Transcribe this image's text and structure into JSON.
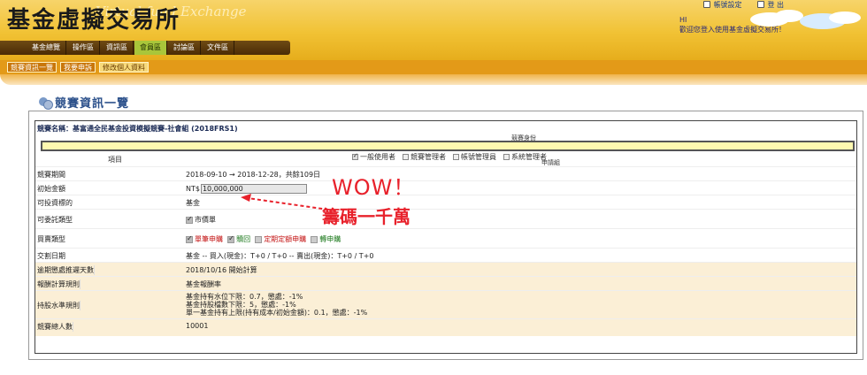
{
  "header": {
    "logo_cn": "基金虛擬交易所",
    "logo_en": "Virtual fund Exchange",
    "top_links": [
      "帳號設定",
      "登 出"
    ],
    "greeting": "HI",
    "welcome": "歡迎您登入使用基金虛擬交易所！"
  },
  "nav": {
    "tabs": [
      "基金總覽",
      "操作區",
      "資訊區",
      "會員區",
      "討論區",
      "文件區"
    ],
    "active": 3
  },
  "subnav": {
    "tabs": [
      "競賽資訊一覽",
      "我要申訴",
      "修改個人資料"
    ],
    "active": 2
  },
  "page": {
    "title": "競賽資訊一覽",
    "competition_name": "競賽名稱：基富通全民基金投資模擬競賽-社會組 (2018FRS1)"
  },
  "roles": {
    "header": "競賽身份",
    "item_label": "項目",
    "options": [
      {
        "label": "一般使用者",
        "checked": true
      },
      {
        "label": "競賽管理者",
        "checked": false
      },
      {
        "label": "帳號管理員",
        "checked": false
      },
      {
        "label": "系統管理者",
        "checked": false
      }
    ],
    "flag_label": "申請組"
  },
  "rows": [
    {
      "label": "競賽期間",
      "value": "2018-09-10 → 2018-12-28，共餘109日"
    },
    {
      "label": "初始金額",
      "prefix": "NT$",
      "input_value": "10,000,000"
    },
    {
      "label": "可投資標的",
      "value": "基金"
    },
    {
      "label": "可委託類型",
      "check_label": "市價單"
    },
    {
      "label": "買賣類型",
      "types": [
        {
          "label": "單筆申購",
          "checked": true,
          "color": "#c41616"
        },
        {
          "label": "贖回",
          "checked": true,
          "color": "#1e7a1e"
        },
        {
          "label": "定期定額申購",
          "checked": false,
          "color": "#c41616"
        },
        {
          "label": "轉申購",
          "checked": false,
          "color": "#1e7a1e"
        }
      ]
    },
    {
      "label": "交割日期",
      "value": "基金 -- 買入(現金)：T+0 / T+0 -- 賣出(現金)：T+0 / T+0"
    },
    {
      "label": "逾期懲處推遲天數",
      "value": "2018/10/16 開始計算"
    },
    {
      "label": "報酬計算規則",
      "value": "基金報酬率"
    },
    {
      "label": "持股水準規則",
      "lines": [
        "基金持有水位下限：0.7，懲處：-1%",
        "基金持股檔數下限：5，懲處：-1%",
        "單一基金持有上限(持有成本/初始金額)：0.1，懲處：-1%"
      ]
    },
    {
      "label": "競賽總人數",
      "value": "10001"
    }
  ],
  "annotation": {
    "wow": "WOW！",
    "note": "籌碼一千萬"
  }
}
